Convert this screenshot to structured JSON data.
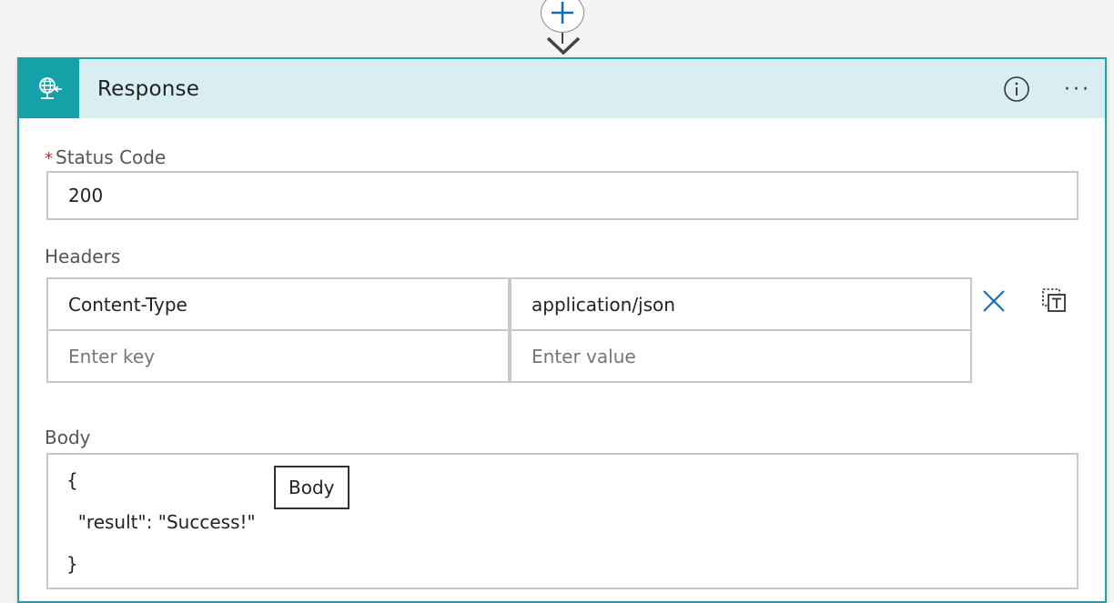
{
  "card": {
    "title": "Response",
    "header_icon": "globe-response-icon",
    "info_icon": "info-icon",
    "more_label": "···"
  },
  "status_code": {
    "required_mark": "*",
    "label": "Status Code",
    "value": "200"
  },
  "headers": {
    "label": "Headers",
    "rows": [
      {
        "key": "Content-Type",
        "value": "application/json"
      }
    ],
    "new_row": {
      "key_placeholder": "Enter key",
      "value_placeholder": "Enter value"
    }
  },
  "body": {
    "label": "Body",
    "lines": [
      "{",
      "  \"result\": \"Success!\"",
      "}"
    ],
    "token_label": "Body"
  },
  "colors": {
    "accent": "#16a0a8",
    "header_bg": "#d8eef1",
    "delete_icon": "#0f6cbd",
    "add_icon": "#0f6cbd"
  }
}
